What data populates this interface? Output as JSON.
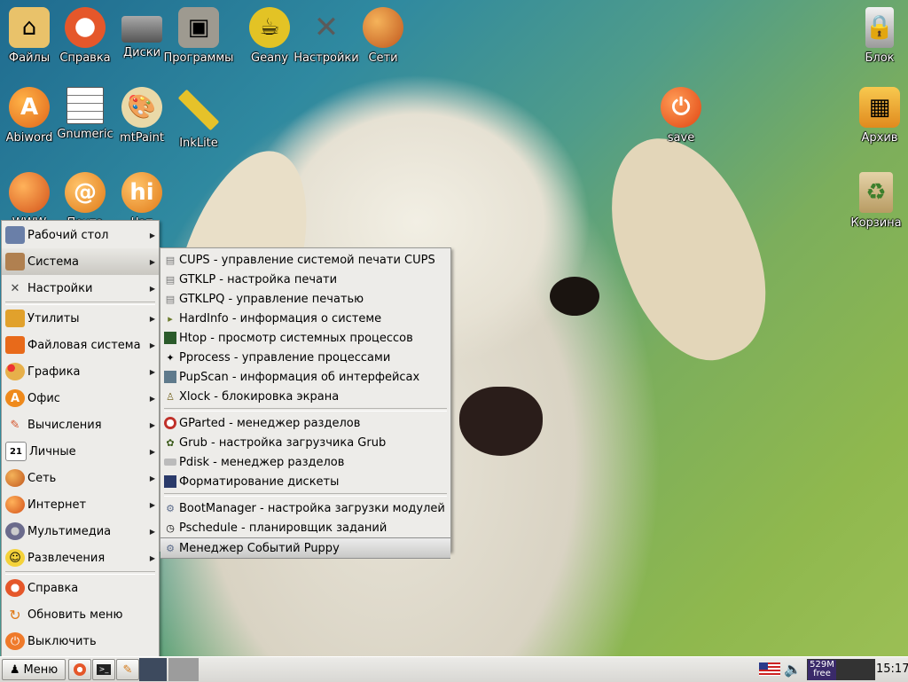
{
  "desktop": {
    "icons": [
      {
        "label": "Файлы",
        "icon": "home-icon"
      },
      {
        "label": "Справка",
        "icon": "lifebuoy-icon"
      },
      {
        "label": "Диски",
        "icon": "drive-icon"
      },
      {
        "label": "Программы",
        "icon": "package-icon"
      },
      {
        "label": "Geany",
        "icon": "teapot-icon"
      },
      {
        "label": "Настройки",
        "icon": "tools-icon"
      },
      {
        "label": "Сети",
        "icon": "network-globe-icon"
      },
      {
        "label": "Блок",
        "icon": "lock-icon"
      },
      {
        "label": "Abiword",
        "icon": "abiword-icon"
      },
      {
        "label": "Gnumeric",
        "icon": "spreadsheet-icon"
      },
      {
        "label": "mtPaint",
        "icon": "palette-icon"
      },
      {
        "label": "InkLite",
        "icon": "ruler-icon"
      },
      {
        "label": "save",
        "icon": "power-icon"
      },
      {
        "label": "Архив",
        "icon": "archive-icon"
      },
      {
        "label": "WWW",
        "icon": "www-globe-icon"
      },
      {
        "label": "Почта",
        "icon": "mail-icon"
      },
      {
        "label": "Чат",
        "icon": "chat-icon"
      },
      {
        "label": "Корзина",
        "icon": "trash-icon"
      }
    ]
  },
  "main_menu": {
    "items": [
      {
        "label": "Рабочий стол",
        "icon": "desktop-icon",
        "has_submenu": true
      },
      {
        "label": "Система",
        "icon": "system-icon",
        "has_submenu": true
      },
      {
        "label": "Настройки",
        "icon": "settings-icon",
        "has_submenu": true
      },
      {
        "label": "Утилиты",
        "icon": "drill-icon",
        "has_submenu": true
      },
      {
        "label": "Файловая система",
        "icon": "folder-icon",
        "has_submenu": true
      },
      {
        "label": "Графика",
        "icon": "graphics-icon",
        "has_submenu": true
      },
      {
        "label": "Офис",
        "icon": "office-icon",
        "has_submenu": true
      },
      {
        "label": "Вычисления",
        "icon": "calc-icon",
        "has_submenu": true
      },
      {
        "label": "Личные",
        "icon": "calendar-icon",
        "has_submenu": true
      },
      {
        "label": "Сеть",
        "icon": "network-icon",
        "has_submenu": true
      },
      {
        "label": "Интернет",
        "icon": "internet-icon",
        "has_submenu": true
      },
      {
        "label": "Мультимедиа",
        "icon": "multimedia-icon",
        "has_submenu": true
      },
      {
        "label": "Развлечения",
        "icon": "games-icon",
        "has_submenu": true
      },
      {
        "label": "Справка",
        "icon": "help-icon",
        "has_submenu": false
      },
      {
        "label": "Обновить меню",
        "icon": "refresh-icon",
        "has_submenu": false
      },
      {
        "label": "Выключить",
        "icon": "shutdown-icon",
        "has_submenu": false
      }
    ],
    "active_index": 1
  },
  "system_submenu": {
    "items": [
      {
        "label": "CUPS - управление системой печати CUPS",
        "icon": "printer-icon"
      },
      {
        "label": "GTKLP - настройка печати",
        "icon": "printer-icon"
      },
      {
        "label": "GTKLPQ - управление печатью",
        "icon": "printer-icon"
      },
      {
        "label": "HardInfo - информация о системе",
        "icon": "hardinfo-icon"
      },
      {
        "label": "Htop - просмотр системных процессов",
        "icon": "terminal-icon"
      },
      {
        "label": "Pprocess - управление процессами",
        "icon": "runner-icon"
      },
      {
        "label": "PupScan - информация об интерфейсах",
        "icon": "scan-icon"
      },
      {
        "label": "Xlock - блокировка экрана",
        "icon": "xlock-icon"
      },
      {
        "label": "GParted - менеджер разделов",
        "icon": "gparted-icon"
      },
      {
        "label": "Grub - настройка загрузчика Grub",
        "icon": "grub-icon"
      },
      {
        "label": "Pdisk - менеджер разделов",
        "icon": "disk-icon"
      },
      {
        "label": "Форматирование дискеты",
        "icon": "floppy-icon"
      },
      {
        "label": "BootManager - настройка загрузки модулей",
        "icon": "gear-icon"
      },
      {
        "label": "Pschedule - планировщик заданий",
        "icon": "clock-icon"
      },
      {
        "label": "Менеджер Событий Puppy",
        "icon": "gear-icon"
      }
    ],
    "highlighted_index": 14
  },
  "taskbar": {
    "menu_label": "Меню",
    "memory_value": "529M",
    "memory_unit": "free",
    "clock": "15:17"
  }
}
